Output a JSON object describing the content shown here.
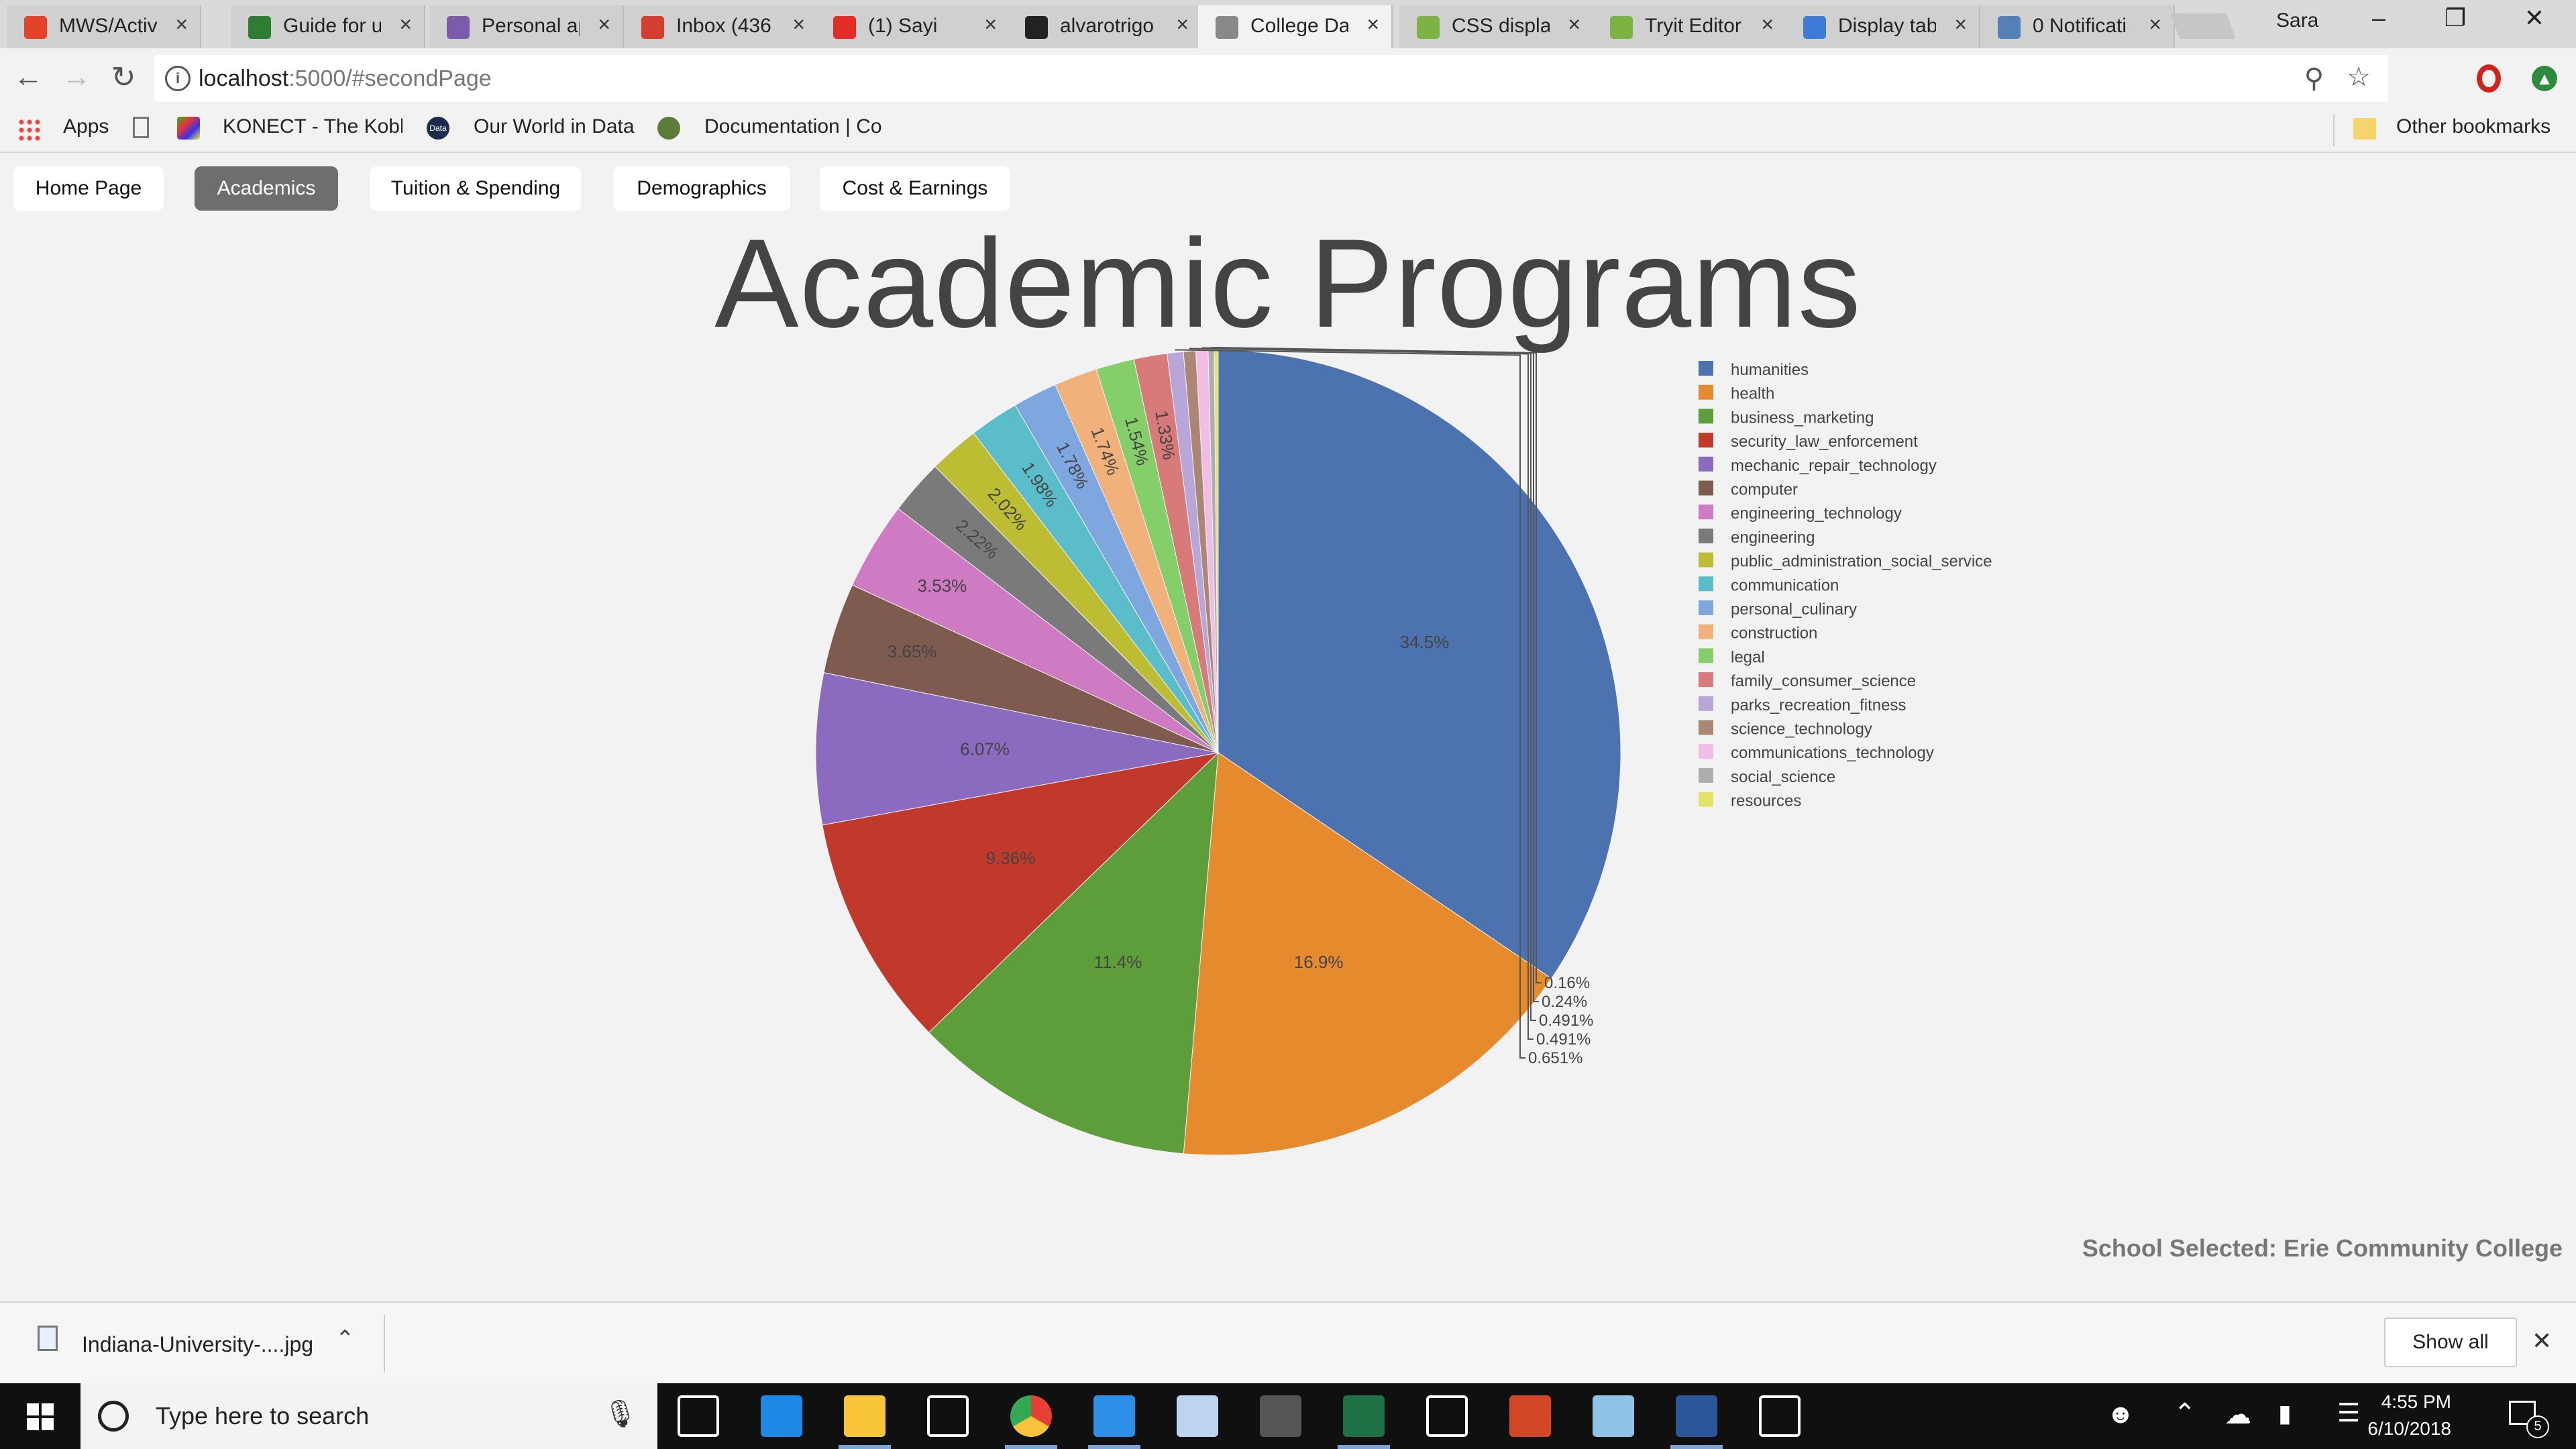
{
  "browser": {
    "tabs": [
      {
        "title": "MWS/Activ",
        "icon": "gitlab-icon",
        "color": "#e24329"
      },
      {
        "title": "Guide for u",
        "icon": "android-icon",
        "color": "#2e7d32"
      },
      {
        "title": "Personal ap",
        "icon": "heroku-icon",
        "color": "#7a5ca8"
      },
      {
        "title": "Inbox (436",
        "icon": "gmail-icon",
        "color": "#d23f31"
      },
      {
        "title": "(1) Sayi",
        "icon": "youtube-icon",
        "color": "#e52d27"
      },
      {
        "title": "alvarotrigo",
        "icon": "github-icon",
        "color": "#222222"
      },
      {
        "title": "College Da",
        "icon": "page-icon",
        "color": "#888888"
      },
      {
        "title": "CSS displa",
        "icon": "w3schools-icon",
        "color": "#7cb342"
      },
      {
        "title": "Tryit Editor",
        "icon": "w3schools-icon",
        "color": "#7cb342"
      },
      {
        "title": "Display tab",
        "icon": "chart-icon",
        "color": "#3d7bd6"
      },
      {
        "title": "0 Notificati",
        "icon": "notification-icon",
        "color": "#5580b5"
      }
    ],
    "active_tab": 6,
    "profile": "Sara",
    "url_host": "localhost",
    "url_path": ":5000/#secondPage",
    "bookmarks": [
      {
        "label": "Apps"
      },
      {
        "label": ""
      },
      {
        "label": "KONECT - The Koble"
      },
      {
        "label": "Our World in Data"
      },
      {
        "label": "Documentation | Co"
      }
    ],
    "other_bookmarks": "Other bookmarks"
  },
  "page": {
    "nav": [
      "Home Page",
      "Academics",
      "Tuition & Spending",
      "Demographics",
      "Cost & Earnings"
    ],
    "active_nav": 1,
    "title": "Academic Programs",
    "school_selected": "School Selected: Erie Community College"
  },
  "chart_data": {
    "type": "pie",
    "title": "",
    "direction": "clockwise",
    "legend": "right",
    "slices": [
      {
        "label": "humanities",
        "value": 34.5,
        "text": "34.5%",
        "color": "#4c72b0"
      },
      {
        "label": "health",
        "value": 16.9,
        "text": "16.9%",
        "color": "#e68a2e"
      },
      {
        "label": "business_marketing",
        "value": 11.4,
        "text": "11.4%",
        "color": "#5d9e3a"
      },
      {
        "label": "security_law_enforcement",
        "value": 9.36,
        "text": "9.36%",
        "color": "#c0392b"
      },
      {
        "label": "mechanic_repair_technology",
        "value": 6.07,
        "text": "6.07%",
        "color": "#8a6bbf"
      },
      {
        "label": "computer",
        "value": 3.65,
        "text": "3.65%",
        "color": "#7f5a4e"
      },
      {
        "label": "engineering_technology",
        "value": 3.53,
        "text": "3.53%",
        "color": "#cf7bc4"
      },
      {
        "label": "engineering",
        "value": 2.22,
        "text": "2.22%",
        "color": "#7a7a7a"
      },
      {
        "label": "public_administration_social_service",
        "value": 2.02,
        "text": "2.02%",
        "color": "#bcbd33"
      },
      {
        "label": "communication",
        "value": 1.98,
        "text": "1.98%",
        "color": "#5bbdc9"
      },
      {
        "label": "personal_culinary",
        "value": 1.78,
        "text": "1.78%",
        "color": "#7ea7e0"
      },
      {
        "label": "construction",
        "value": 1.74,
        "text": "1.74%",
        "color": "#f0b27a"
      },
      {
        "label": "legal",
        "value": 1.54,
        "text": "1.54%",
        "color": "#84cf6a"
      },
      {
        "label": "family_consumer_science",
        "value": 1.33,
        "text": "1.33%",
        "color": "#d97a7a"
      },
      {
        "label": "parks_recreation_fitness",
        "value": 0.651,
        "text": "0.651%",
        "color": "#b9a6d8"
      },
      {
        "label": "science_technology",
        "value": 0.491,
        "text": "0.491%",
        "color": "#ab8674"
      },
      {
        "label": "communications_technology",
        "value": 0.491,
        "text": "0.491%",
        "color": "#f0bde5"
      },
      {
        "label": "social_science",
        "value": 0.24,
        "text": "0.24%",
        "color": "#adadad"
      },
      {
        "label": "resources",
        "value": 0.16,
        "text": "0.16%",
        "color": "#e3e36a"
      }
    ]
  },
  "downloads": {
    "filename": "Indiana-University-....jpg",
    "show_all": "Show all"
  },
  "taskbar": {
    "search_placeholder": "Type here to search",
    "time": "4:55 PM",
    "date": "6/10/2018",
    "notifications": "5",
    "apps": [
      {
        "name": "task-view",
        "color": "#ffffff"
      },
      {
        "name": "edge",
        "color": "#1e88e5"
      },
      {
        "name": "file-explorer",
        "color": "#f9c63b"
      },
      {
        "name": "store",
        "color": "#ffffff"
      },
      {
        "name": "chrome",
        "color": "#e44134"
      },
      {
        "name": "vscode",
        "color": "#2c8ee6"
      },
      {
        "name": "snipping",
        "color": "#bcd4ef"
      },
      {
        "name": "terminal",
        "color": "#555555"
      },
      {
        "name": "excel",
        "color": "#1e7145"
      },
      {
        "name": "settings",
        "color": "#ffffff"
      },
      {
        "name": "powerpoint",
        "color": "#d24726"
      },
      {
        "name": "notepad",
        "color": "#8fc4e8"
      },
      {
        "name": "word",
        "color": "#2b579a"
      },
      {
        "name": "slack",
        "color": "#ffffff"
      }
    ]
  }
}
